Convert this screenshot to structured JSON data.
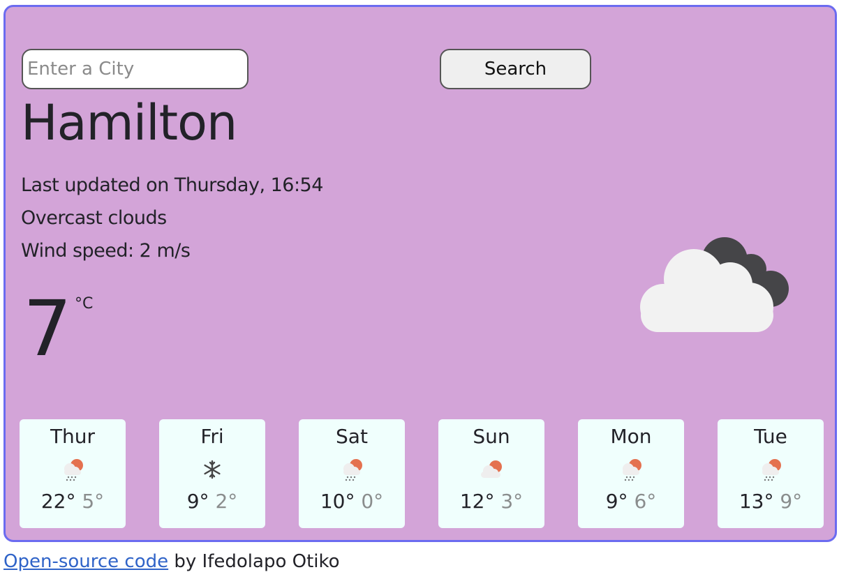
{
  "search": {
    "placeholder": "Enter a City",
    "value": "",
    "button_label": "Search"
  },
  "current": {
    "city": "Hamilton",
    "last_updated": "Last updated on Thursday, 16:54",
    "description": "Overcast clouds",
    "wind": "Wind speed: 2 m/s",
    "temperature": "7",
    "unit": "°C",
    "icon": "overcast-clouds-icon"
  },
  "forecast": [
    {
      "day": "Thur",
      "icon": "light-rain-icon",
      "max": "22°",
      "min": "5°"
    },
    {
      "day": "Fri",
      "icon": "snowflake-icon",
      "max": "9°",
      "min": "2°"
    },
    {
      "day": "Sat",
      "icon": "light-rain-icon",
      "max": "10°",
      "min": "0°"
    },
    {
      "day": "Sun",
      "icon": "partly-cloudy-icon",
      "max": "12°",
      "min": "3°"
    },
    {
      "day": "Mon",
      "icon": "light-rain-icon",
      "max": "9°",
      "min": "6°"
    },
    {
      "day": "Tue",
      "icon": "light-rain-icon",
      "max": "13°",
      "min": "9°"
    }
  ],
  "footer": {
    "link_text": "Open-source code",
    "byline": " by Ifedolapo Otiko"
  },
  "colors": {
    "background": "#d3a4d8",
    "border": "#6b6bf0",
    "card": "#f0fffd",
    "sun": "#e4714f",
    "link": "#2f63c8"
  }
}
